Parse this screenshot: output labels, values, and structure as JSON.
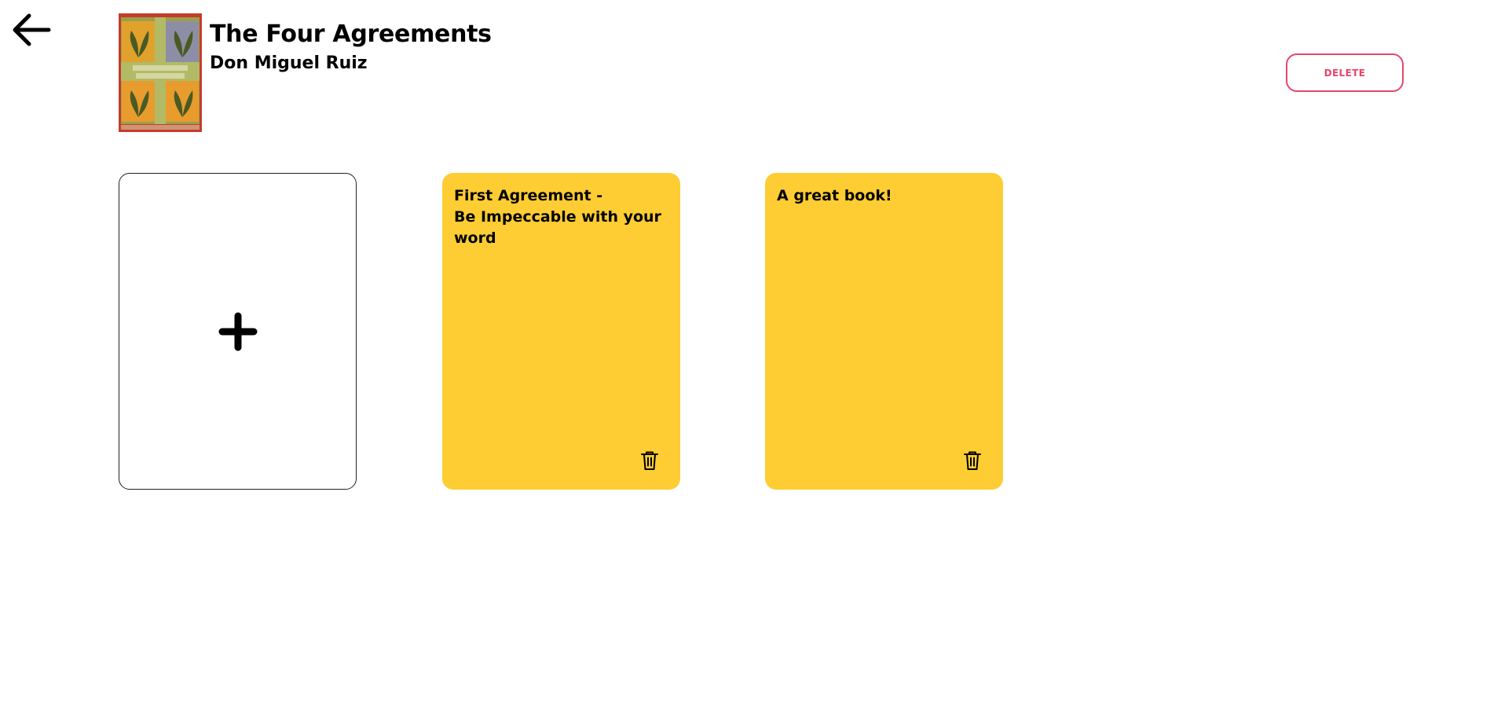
{
  "book": {
    "title": "The Four Agreements",
    "author": "Don Miguel Ruiz",
    "cover_icon": "book-cover-image"
  },
  "actions": {
    "delete_label": "DELETE",
    "delete_color": "#e8466a",
    "back_icon": "arrow-left-icon",
    "add_icon": "plus-icon"
  },
  "notes": [
    {
      "text": "First Agreement -\nBe Impeccable with your word",
      "icon": "trash-icon"
    },
    {
      "text": "A great book!",
      "icon": "trash-icon"
    }
  ],
  "colors": {
    "note_background": "#fecd33",
    "accent": "#e8466a"
  }
}
